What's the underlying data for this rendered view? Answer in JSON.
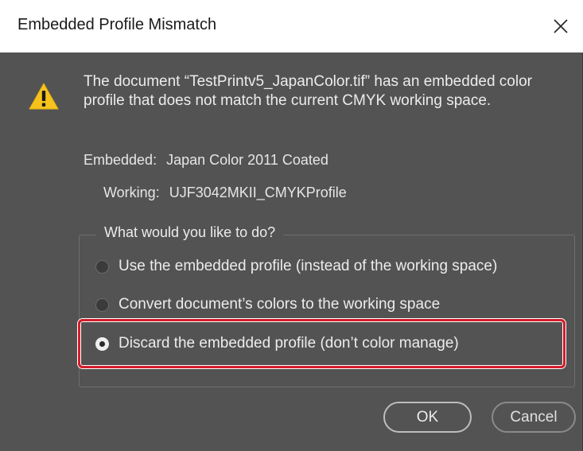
{
  "dialog": {
    "title": "Embedded Profile Mismatch",
    "close_glyph": "✕",
    "message": "The document “TestPrintv5_JapanColor.tif” has an embedded color profile that does not match the current CMYK working space.",
    "embedded_label": "Embedded:",
    "embedded_value": "Japan Color 2011 Coated",
    "working_label": "Working:",
    "working_value": "UJF3042MKII_CMYKProfile",
    "question": "What would you like to do?",
    "options": [
      {
        "label": "Use the embedded profile (instead of the working space)",
        "checked": false
      },
      {
        "label": "Convert document’s colors to the working space",
        "checked": false
      },
      {
        "label": "Discard the embedded profile (don’t color manage)",
        "checked": true
      }
    ],
    "ok_label": "OK",
    "cancel_label": "Cancel"
  },
  "icons": {
    "warning": "warning-icon",
    "close": "close-icon"
  },
  "colors": {
    "dialog_bg": "#535353",
    "warning_yellow": "#f5c31c",
    "highlight_red": "#d41d2a"
  }
}
